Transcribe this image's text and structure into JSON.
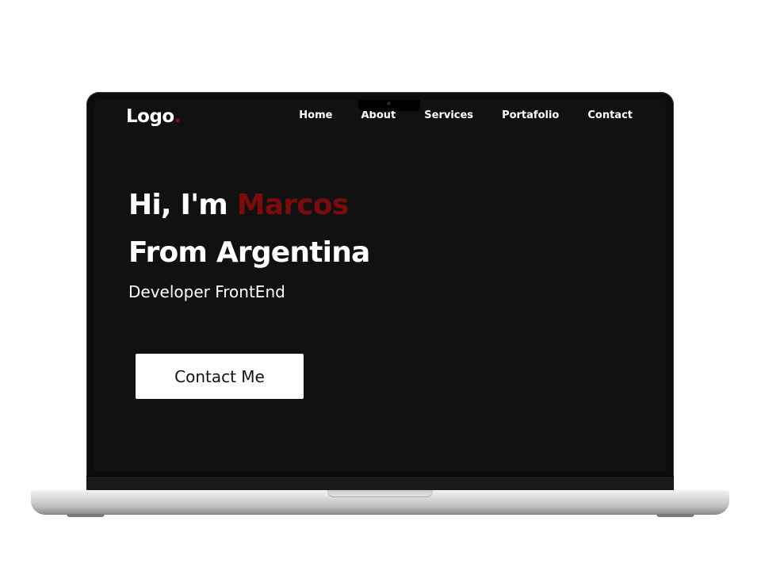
{
  "nav": {
    "logo_text": "Logo",
    "logo_dot": ".",
    "links": [
      {
        "label": "Home"
      },
      {
        "label": "About"
      },
      {
        "label": "Services"
      },
      {
        "label": "Portafolio"
      },
      {
        "label": "Contact"
      }
    ]
  },
  "hero": {
    "greeting": "Hi, I'm ",
    "name": "Marcos",
    "origin": "From Argentina",
    "role": "Developer FrontEnd",
    "cta_label": "Contact Me"
  },
  "colors": {
    "accent": "#7e0b0b",
    "background": "#111112",
    "text": "#ffffff"
  }
}
